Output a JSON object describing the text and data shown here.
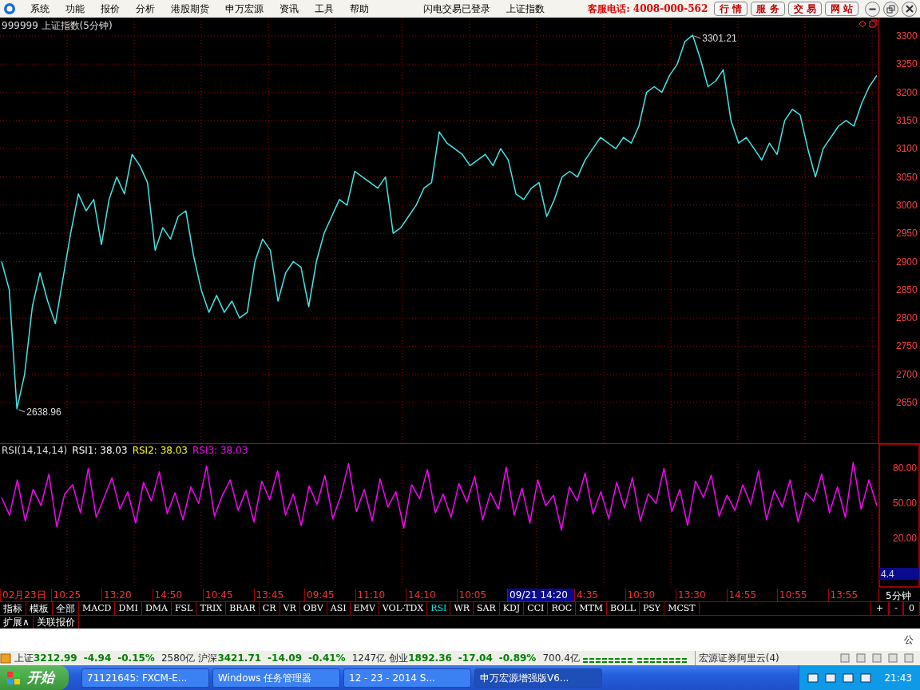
{
  "menu_bar": {
    "items": [
      "系统",
      "功能",
      "报价",
      "分析",
      "港股期货",
      "申万宏源",
      "资讯",
      "工具",
      "帮助"
    ],
    "status": [
      "闪电交易已登录",
      "上证指数"
    ],
    "hotline": "客服电话: 4008-000-562",
    "buttons": [
      "行 情",
      "服 务",
      "交 易",
      "网 站"
    ]
  },
  "price_pane": {
    "title": "999999 上证指数(5分钟)",
    "chart_data": {
      "type": "line",
      "grid": true,
      "ylim": [
        2578,
        3332.5
      ],
      "yticks": [
        2650,
        2700,
        2750,
        2800,
        2850,
        2900,
        2950,
        3000,
        3050,
        3100,
        3150,
        3200,
        3250,
        3300
      ],
      "series": [
        {
          "color": "#40e8e8",
          "values": [
            2900,
            2850,
            2638.96,
            2700,
            2820,
            2880,
            2830,
            2790,
            2870,
            2950,
            3020,
            2990,
            3010,
            2930,
            3010,
            3050,
            3020,
            3090,
            3070,
            3040,
            2920,
            2960,
            2940,
            2980,
            2990,
            2910,
            2850,
            2810,
            2840,
            2810,
            2830,
            2800,
            2810,
            2900,
            2940,
            2920,
            2830,
            2880,
            2900,
            2890,
            2820,
            2900,
            2950,
            2980,
            3010,
            3000,
            3060,
            3050,
            3040,
            3030,
            3050,
            2950,
            2960,
            2980,
            3000,
            3030,
            3040,
            3130,
            3110,
            3100,
            3090,
            3070,
            3080,
            3090,
            3070,
            3100,
            3080,
            3020,
            3010,
            3030,
            3040,
            2980,
            3010,
            3050,
            3060,
            3050,
            3080,
            3100,
            3120,
            3110,
            3100,
            3120,
            3110,
            3140,
            3200,
            3210,
            3200,
            3230,
            3250,
            3290,
            3301.21,
            3260,
            3210,
            3220,
            3240,
            3150,
            3110,
            3120,
            3100,
            3080,
            3110,
            3090,
            3150,
            3170,
            3160,
            3100,
            3050,
            3100,
            3120,
            3140,
            3150,
            3140,
            3180,
            3210,
            3230
          ]
        }
      ],
      "annotations": [
        "3301.21",
        "2638.96"
      ]
    }
  },
  "rsi_pane": {
    "label": "RSI(14,14,14)",
    "readings": [
      {
        "text": "RSI1: 38.03",
        "color": "#ffffff"
      },
      {
        "text": "RSI2: 38.03",
        "color": "#ffff00"
      },
      {
        "text": "RSI3: 38.03",
        "color": "#ff00ff"
      }
    ],
    "value_box": "4.4",
    "chart_data": {
      "type": "line",
      "grid": true,
      "ylim": [
        -23,
        101.5
      ],
      "yticks": [
        {
          "value": 80,
          "label": "80.00"
        },
        {
          "value": 50,
          "label": "50.00"
        },
        {
          "value": 20,
          "label": "20.00"
        }
      ],
      "series": [
        {
          "color": "#ff00ff",
          "values": [
            55,
            40,
            70,
            35,
            62,
            48,
            75,
            30,
            58,
            66,
            42,
            80,
            38,
            55,
            72,
            45,
            60,
            33,
            68,
            52,
            77,
            41,
            59,
            36,
            64,
            50,
            82,
            39,
            57,
            70,
            44,
            61,
            34,
            69,
            53,
            78,
            40,
            58,
            31,
            65,
            49,
            74,
            37,
            56,
            84,
            43,
            62,
            35,
            71,
            47,
            60,
            29,
            66,
            54,
            79,
            42,
            58,
            38,
            67,
            51,
            73,
            36,
            59,
            45,
            81,
            40,
            63,
            33,
            70,
            48,
            57,
            27,
            64,
            52,
            76,
            41,
            60,
            37,
            68,
            46,
            72,
            35,
            58,
            50,
            80,
            43,
            62,
            31,
            69,
            55,
            74,
            39,
            57,
            44,
            66,
            49,
            78,
            36,
            61,
            47,
            70,
            34,
            59,
            52,
            75,
            42,
            64,
            38,
            85,
            45,
            70,
            48
          ]
        }
      ]
    }
  },
  "time_axis": {
    "labels": [
      {
        "text": "02月23日",
        "selected": false
      },
      {
        "text": "10:25",
        "selected": false
      },
      {
        "text": "13:20",
        "selected": false
      },
      {
        "text": "14:50",
        "selected": false
      },
      {
        "text": "10:45",
        "selected": false
      },
      {
        "text": "13:45",
        "selected": false
      },
      {
        "text": "09:45",
        "selected": false
      },
      {
        "text": "11:10",
        "selected": false
      },
      {
        "text": "14:10",
        "selected": false
      },
      {
        "text": "10:05",
        "selected": false
      },
      {
        "text": "09/21 14:20",
        "selected": true
      },
      {
        "text": "4:35",
        "selected": false
      },
      {
        "text": "10:30",
        "selected": false
      },
      {
        "text": "13:30",
        "selected": false
      },
      {
        "text": "14:55",
        "selected": false
      },
      {
        "text": "10:55",
        "selected": false
      },
      {
        "text": "13:55",
        "selected": false
      }
    ],
    "period": "5分钟"
  },
  "indicator_tabs": [
    {
      "label": "指标",
      "selected": false
    },
    {
      "label": "模板",
      "selected": false
    },
    {
      "label": "全部",
      "selected": false
    },
    {
      "label": "MACD",
      "selected": false
    },
    {
      "label": "DMI",
      "selected": false
    },
    {
      "label": "DMA",
      "selected": false
    },
    {
      "label": "FSL",
      "selected": false
    },
    {
      "label": "TRIX",
      "selected": false
    },
    {
      "label": "BRAR",
      "selected": false
    },
    {
      "label": "CR",
      "selected": false
    },
    {
      "label": "VR",
      "selected": false
    },
    {
      "label": "OBV",
      "selected": false
    },
    {
      "label": "ASI",
      "selected": false
    },
    {
      "label": "EMV",
      "selected": false
    },
    {
      "label": "VOL-TDX",
      "selected": false
    },
    {
      "label": "RSI",
      "selected": true
    },
    {
      "label": "WR",
      "selected": false
    },
    {
      "label": "SAR",
      "selected": false
    },
    {
      "label": "KDJ",
      "selected": false
    },
    {
      "label": "CCI",
      "selected": false
    },
    {
      "label": "ROC",
      "selected": false
    },
    {
      "label": "MTM",
      "selected": false
    },
    {
      "label": "BOLL",
      "selected": false
    },
    {
      "label": "PSY",
      "selected": false
    },
    {
      "label": "MCST",
      "selected": false
    }
  ],
  "zoom_buttons": [
    "+",
    "-",
    "0"
  ],
  "extra_tabs": [
    "扩展∧",
    "关联报价"
  ],
  "input_hint": "公",
  "status_bar": {
    "indices": [
      {
        "name": "上证",
        "price": "3212.99",
        "change": "-4.94",
        "percent": "-0.15%",
        "volume": "2580亿"
      },
      {
        "name": "沪深",
        "price": "3421.71",
        "change": "-14.09",
        "percent": "-0.41%",
        "volume": "1247亿"
      },
      {
        "name": "创业",
        "price": "1892.36",
        "change": "-17.04",
        "percent": "-0.89%",
        "volume": "700.4亿"
      }
    ],
    "server": "宏源证券阿里云(4)"
  },
  "taskbar": {
    "start": "开始",
    "tasks": [
      {
        "label": "71121645: FXCM-E...",
        "selected": false
      },
      {
        "label": "Windows 任务管理器",
        "selected": false
      },
      {
        "label": "12 - 23 - 2014 S...",
        "selected": false
      },
      {
        "label": "申万宏源增强版V6...",
        "selected": true
      }
    ],
    "clock": "21:43"
  }
}
